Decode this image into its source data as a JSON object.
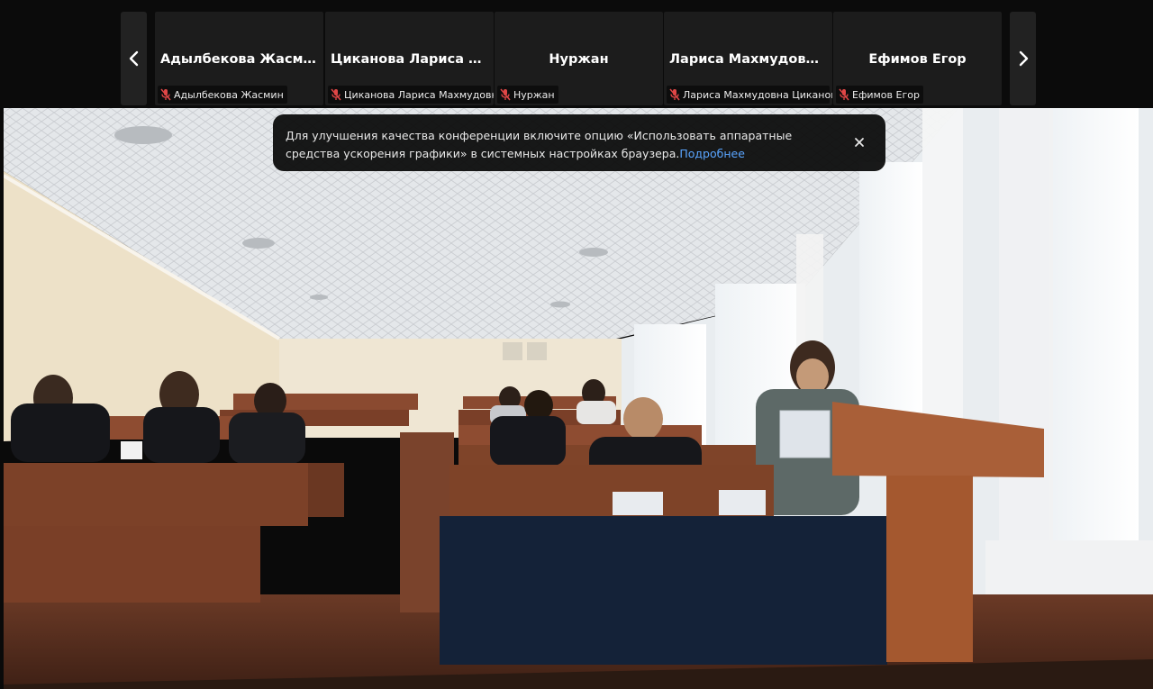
{
  "participants": [
    {
      "name": "Адылбекова Жасмин",
      "label": "Адылбекова Жасмин"
    },
    {
      "name": "Циканова Лариса Мах...",
      "label": "Циканова Лариса Махмудовна"
    },
    {
      "name": "Нуржан",
      "label": "Нуржан"
    },
    {
      "name": "Лариса Махмудовна Ц...",
      "label": "Лариса Махмудовна Циканова"
    },
    {
      "name": "Ефимов Егор",
      "label": "Ефимов Егор"
    }
  ],
  "icons": {
    "prev": "chevron-left-icon",
    "next": "chevron-right-icon",
    "mic": "mic-off-icon",
    "close": "close-icon"
  },
  "colors": {
    "mic_muted": "#e04646",
    "link": "#5aa5ff"
  },
  "toast": {
    "text": "Для улучшения качества конференции включите опцию «Использовать аппаратные средства ускорения графики» в системных настройках браузера.",
    "link_text": "Подробнее"
  }
}
